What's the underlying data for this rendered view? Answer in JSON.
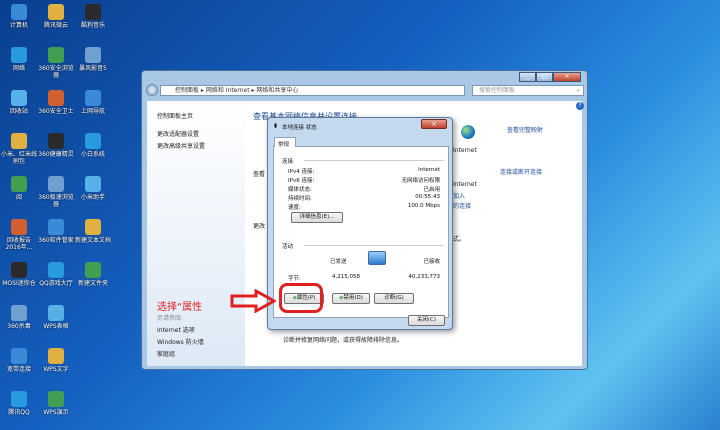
{
  "desktop": {
    "icons": [
      [
        "计算机",
        "网络",
        "回收站",
        "小米、红米线刷包",
        "阅",
        "回收报告2016年...",
        "MOSI迷你仓",
        "360杀毒",
        "宽带连接",
        "腾讯QQ"
      ],
      [
        "腾讯微云",
        "360安全浏览器",
        "360安全卫士",
        "360健康精灵",
        "360极速浏览器",
        "360软件管家",
        "QQ游戏大厅",
        "WPS表格",
        "WPS文字",
        "WPS演示"
      ],
      [
        "酷狗音乐",
        "暴风影音5",
        "上网导航",
        "小白系统",
        "小米助手",
        "新建文本文档",
        "新建文件夹"
      ]
    ]
  },
  "window": {
    "breadcrumb": [
      "控制面板",
      "网络和 Internet",
      "网络和共享中心"
    ],
    "search_placeholder": "搜索控制面板",
    "left": {
      "home": "控制面板主页",
      "adapter": "更改适配器设置",
      "sharing": "更改高级共享设置",
      "see_also": "另请参阅",
      "internet_options": "Internet 选项",
      "firewall": "Windows 防火墙",
      "homegroup": "家庭组"
    },
    "main": {
      "title": "查看基本网络信息并设置连接",
      "view_map": "查看完整映射",
      "internet": "Internet",
      "connect": "连接或断开连接",
      "view1": "查看",
      "change": "更改",
      "access": "Internet",
      "join": "加入",
      "conn_link": "的连接",
      "suffix": "式。",
      "diagnose": "诊断并修复网络问题，或获得故障排除信息。"
    }
  },
  "dialog": {
    "title": "本地连接 状态",
    "tab": "常规",
    "connection": "连接",
    "rows": [
      {
        "k": "IPv4 连接:",
        "v": "Internet"
      },
      {
        "k": "IPv6 连接:",
        "v": "无网络访问权限"
      },
      {
        "k": "媒体状态:",
        "v": "已启用"
      },
      {
        "k": "持续时间:",
        "v": "00:55:43"
      },
      {
        "k": "速度:",
        "v": "100.0 Mbps"
      }
    ],
    "details": "详细信息(E)...",
    "activity": "活动",
    "sent": "已发送",
    "received": "已接收",
    "bytes": "字节:",
    "sent_val": "4,215,058",
    "recv_val": "40,233,773",
    "properties": "属性(P)",
    "disable": "禁用(D)",
    "diagnose": "诊断(G)",
    "close": "关闭(C)"
  },
  "annotation": {
    "text": "选择“属性",
    "color": "#e02020"
  }
}
